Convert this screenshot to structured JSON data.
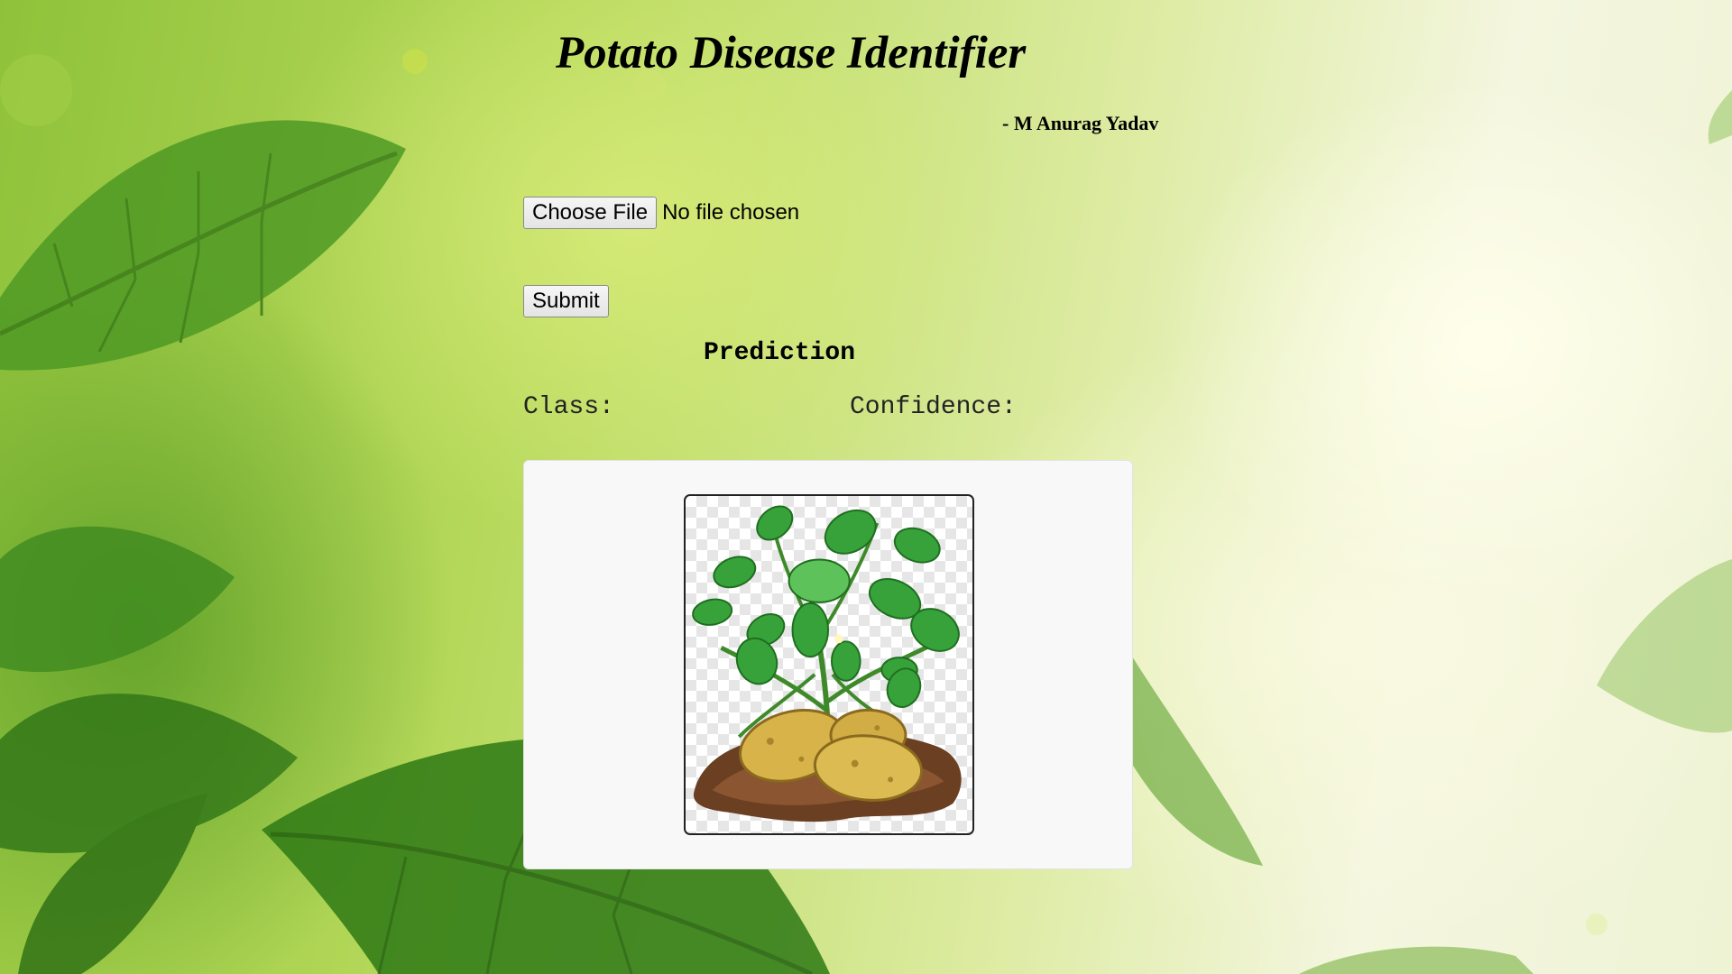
{
  "header": {
    "title": "Potato Disease Identifier",
    "author": "- M Anurag Yadav"
  },
  "upload": {
    "choose_file_label": "Choose File",
    "file_status": "No file chosen",
    "submit_label": "Submit"
  },
  "prediction": {
    "heading": "Prediction",
    "class_label": "Class:",
    "confidence_label": "Confidence:"
  },
  "preview_image": {
    "icon": "potato-plant-icon"
  },
  "colors": {
    "background_green": "#8fc23a",
    "background_light": "#f4f6df",
    "card_background": "#f8f8f8"
  }
}
